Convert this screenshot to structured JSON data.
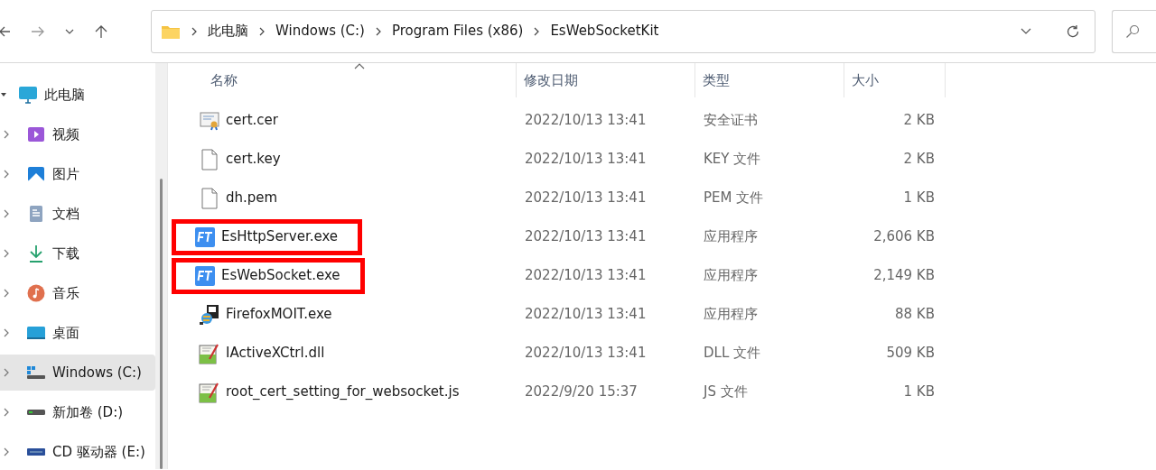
{
  "breadcrumb": [
    "此电脑",
    "Windows (C:)",
    "Program Files (x86)",
    "EsWebSocketKit"
  ],
  "sidebar": {
    "items": [
      {
        "label": "此电脑",
        "kind": "pc",
        "expanded": true,
        "selected": false
      },
      {
        "label": "视频",
        "kind": "video",
        "expanded": false,
        "selected": false
      },
      {
        "label": "图片",
        "kind": "picture",
        "expanded": false,
        "selected": false
      },
      {
        "label": "文档",
        "kind": "document",
        "expanded": false,
        "selected": false
      },
      {
        "label": "下载",
        "kind": "download",
        "expanded": false,
        "selected": false
      },
      {
        "label": "音乐",
        "kind": "music",
        "expanded": false,
        "selected": false
      },
      {
        "label": "桌面",
        "kind": "desktop",
        "expanded": false,
        "selected": false
      },
      {
        "label": "Windows (C:)",
        "kind": "system-drive",
        "expanded": false,
        "selected": true
      },
      {
        "label": "新加卷 (D:)",
        "kind": "drive",
        "expanded": false,
        "selected": false
      },
      {
        "label": "CD 驱动器 (E:)",
        "kind": "cd",
        "expanded": false,
        "selected": false
      }
    ]
  },
  "table": {
    "columns": [
      "名称",
      "修改日期",
      "类型",
      "大小"
    ],
    "rows": [
      {
        "name": "cert.cer",
        "kind": "certificate",
        "date": "2022/10/13 13:41",
        "type": "安全证书",
        "size": "2 KB",
        "highlighted": false
      },
      {
        "name": "cert.key",
        "kind": "blank",
        "date": "2022/10/13 13:41",
        "type": "KEY 文件",
        "size": "2 KB",
        "highlighted": false
      },
      {
        "name": "dh.pem",
        "kind": "blank",
        "date": "2022/10/13 13:41",
        "type": "PEM 文件",
        "size": "1 KB",
        "highlighted": false
      },
      {
        "name": "EsHttpServer.exe",
        "kind": "ft",
        "date": "2022/10/13 13:41",
        "type": "应用程序",
        "size": "2,606 KB",
        "highlighted": true
      },
      {
        "name": "EsWebSocket.exe",
        "kind": "ft",
        "date": "2022/10/13 13:41",
        "type": "应用程序",
        "size": "2,149 KB",
        "highlighted": true
      },
      {
        "name": "FirefoxMOIT.exe",
        "kind": "installer",
        "date": "2022/10/13 13:41",
        "type": "应用程序",
        "size": "88 KB",
        "highlighted": false
      },
      {
        "name": "IActiveXCtrl.dll",
        "kind": "script",
        "date": "2022/10/13 13:41",
        "type": "DLL 文件",
        "size": "509 KB",
        "highlighted": false
      },
      {
        "name": "root_cert_setting_for_websocket.js",
        "kind": "script",
        "date": "2022/9/20 15:37",
        "type": "JS 文件",
        "size": "1 KB",
        "highlighted": false
      }
    ]
  }
}
